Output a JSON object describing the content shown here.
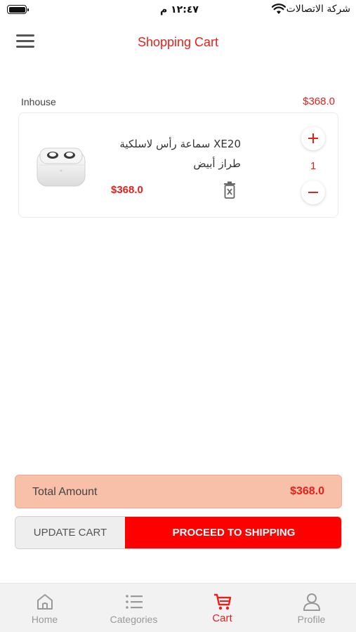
{
  "status_bar": {
    "time": "١٢:٤٧ م",
    "carrier": "شركة الاتصالات"
  },
  "header": {
    "title": "Shopping Cart"
  },
  "cart": {
    "seller_name": "Inhouse",
    "seller_total": "$368.0",
    "items": [
      {
        "name": "XE20 سماعة رأس لاسلكية طراز أبيض",
        "price": "$368.0",
        "quantity": "1"
      }
    ]
  },
  "summary": {
    "total_label": "Total Amount",
    "total_value": "$368.0"
  },
  "actions": {
    "update_label": "UPDATE CART",
    "proceed_label": "PROCEED TO SHIPPING"
  },
  "nav": {
    "items": [
      {
        "label": "Home",
        "icon": "home-icon",
        "active": false
      },
      {
        "label": "Categories",
        "icon": "list-icon",
        "active": false
      },
      {
        "label": "Cart",
        "icon": "cart-icon",
        "active": true
      },
      {
        "label": "Profile",
        "icon": "user-icon",
        "active": false
      }
    ]
  },
  "colors": {
    "accent": "#e8201b",
    "proceed_bg": "#ff0000",
    "total_bg": "#f8bfa9"
  }
}
